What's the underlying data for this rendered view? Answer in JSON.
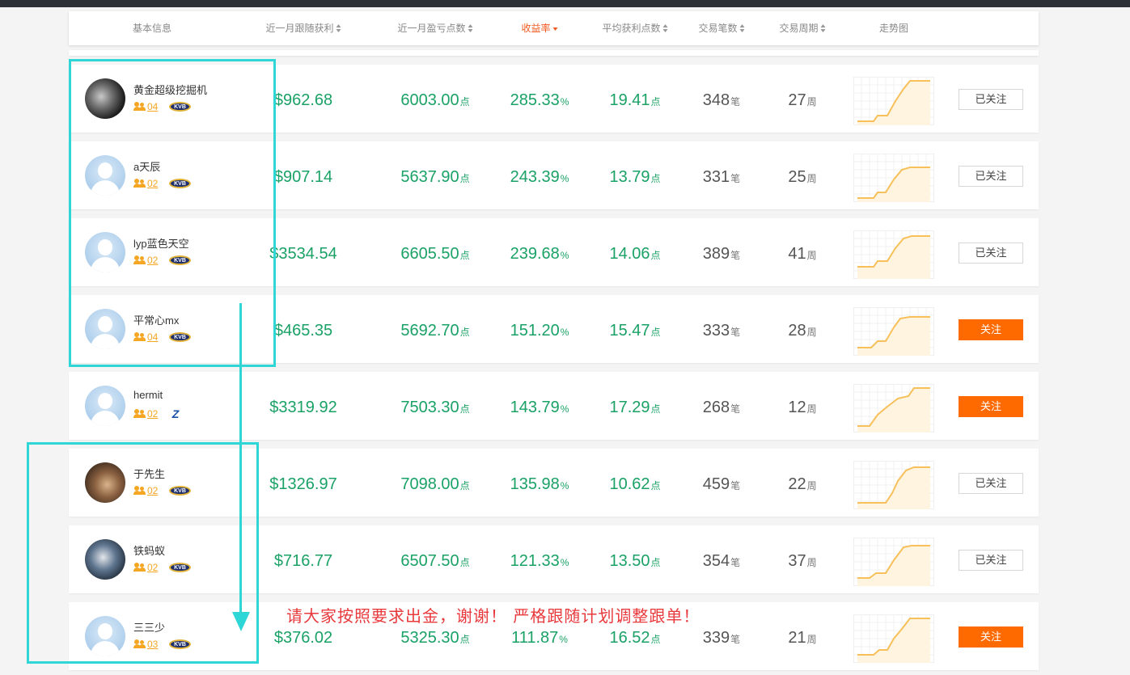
{
  "header": {
    "columns": [
      {
        "label": "基本信息",
        "sort": "none"
      },
      {
        "label": "近一月跟随获利",
        "sort": "both"
      },
      {
        "label": "近一月盈亏点数",
        "sort": "both"
      },
      {
        "label": "收益率",
        "sort": "desc",
        "active": true
      },
      {
        "label": "平均获利点数",
        "sort": "both"
      },
      {
        "label": "交易笔数",
        "sort": "both"
      },
      {
        "label": "交易周期",
        "sort": "both"
      },
      {
        "label": "走势图",
        "sort": "none"
      }
    ]
  },
  "units": {
    "points": "点",
    "percent": "%",
    "trades": "笔",
    "weeks": "周"
  },
  "rows": [
    {
      "name": "黄金超级挖掘机",
      "fans": "04",
      "broker": "KVB",
      "avatar": "photo1",
      "profit": "$962.68",
      "points": "6003.00",
      "yield": "285.33",
      "avg": "19.41",
      "trades": "348",
      "weeks": "27",
      "action": "已关注",
      "followed": true
    },
    {
      "name": "a天辰",
      "fans": "02",
      "broker": "KVB",
      "avatar": "default",
      "profit": "$907.14",
      "points": "5637.90",
      "yield": "243.39",
      "avg": "13.79",
      "trades": "331",
      "weeks": "25",
      "action": "已关注",
      "followed": true
    },
    {
      "name": "lyp蓝色天空",
      "fans": "02",
      "broker": "KVB",
      "avatar": "default",
      "profit": "$3534.54",
      "points": "6605.50",
      "yield": "239.68",
      "avg": "14.06",
      "trades": "389",
      "weeks": "41",
      "action": "已关注",
      "followed": true
    },
    {
      "name": "平常心mx",
      "fans": "04",
      "broker": "KVB",
      "avatar": "default",
      "profit": "$465.35",
      "points": "5692.70",
      "yield": "151.20",
      "avg": "15.47",
      "trades": "333",
      "weeks": "28",
      "action": "关注",
      "followed": false
    },
    {
      "name": "hermit",
      "fans": "02",
      "broker": "Z",
      "avatar": "default",
      "profit": "$3319.92",
      "points": "7503.30",
      "yield": "143.79",
      "avg": "17.29",
      "trades": "268",
      "weeks": "12",
      "action": "关注",
      "followed": false
    },
    {
      "name": "于先生",
      "fans": "02",
      "broker": "KVB",
      "avatar": "photo2",
      "profit": "$1326.97",
      "points": "7098.00",
      "yield": "135.98",
      "avg": "10.62",
      "trades": "459",
      "weeks": "22",
      "action": "已关注",
      "followed": true
    },
    {
      "name": "铁蚂蚁",
      "fans": "02",
      "broker": "KVB",
      "avatar": "photo3",
      "profit": "$716.77",
      "points": "6507.50",
      "yield": "121.33",
      "avg": "13.50",
      "trades": "354",
      "weeks": "37",
      "action": "已关注",
      "followed": true
    },
    {
      "name": "三三少",
      "fans": "03",
      "broker": "KVB",
      "avatar": "default",
      "profit": "$376.02",
      "points": "5325.30",
      "yield": "111.87",
      "avg": "16.52",
      "trades": "339",
      "weeks": "21",
      "action": "关注",
      "followed": false
    }
  ],
  "annotation": {
    "note": "请大家按照要求出金，谢谢！ 严格跟随计划调整跟单！"
  },
  "colors": {
    "accent": "#f25a1f",
    "green": "#1aa166",
    "highlight": "#2fd6d6",
    "follow_button": "#ff6a00",
    "trend_line": "#f7c05a",
    "note": "#e8393c"
  }
}
